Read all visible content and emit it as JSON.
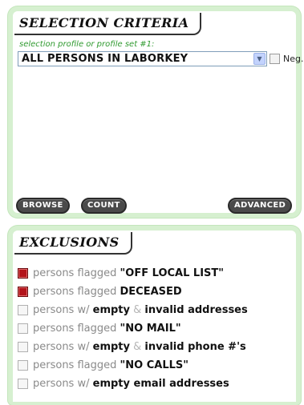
{
  "selection_criteria": {
    "title": "SELECTION CRITERIA",
    "hint": "selection profile or profile set #1:",
    "selected_profile": "ALL PERSONS IN LABORKEY",
    "neg_label": "Neg.",
    "buttons": {
      "browse": "BROWSE",
      "count": "COUNT",
      "advanced": "ADVANCED"
    }
  },
  "exclusions": {
    "title": "EXCLUSIONS",
    "items": [
      {
        "checked": true,
        "parts": [
          {
            "t": "persons flagged ",
            "s": "muted"
          },
          {
            "t": "\"OFF LOCAL LIST\"",
            "s": "strong"
          }
        ]
      },
      {
        "checked": true,
        "parts": [
          {
            "t": "persons flagged ",
            "s": "muted"
          },
          {
            "t": "DECEASED",
            "s": "strong"
          }
        ]
      },
      {
        "checked": false,
        "parts": [
          {
            "t": "persons w/ ",
            "s": "muted"
          },
          {
            "t": "empty",
            "s": "strong"
          },
          {
            "t": " & ",
            "s": "amp"
          },
          {
            "t": "invalid addresses",
            "s": "strong"
          }
        ]
      },
      {
        "checked": false,
        "parts": [
          {
            "t": "persons flagged ",
            "s": "muted"
          },
          {
            "t": "\"NO MAIL\"",
            "s": "strong"
          }
        ]
      },
      {
        "checked": false,
        "parts": [
          {
            "t": "persons w/ ",
            "s": "muted"
          },
          {
            "t": "empty",
            "s": "strong"
          },
          {
            "t": " & ",
            "s": "amp"
          },
          {
            "t": "invalid phone #'s",
            "s": "strong"
          }
        ]
      },
      {
        "checked": false,
        "parts": [
          {
            "t": "persons flagged ",
            "s": "muted"
          },
          {
            "t": "\"NO CALLS\"",
            "s": "strong"
          }
        ]
      },
      {
        "checked": false,
        "parts": [
          {
            "t": "persons w/ ",
            "s": "muted"
          },
          {
            "t": "empty email addresses",
            "s": "strong"
          }
        ]
      }
    ]
  },
  "colors": {
    "panel_border": "#d6f0d0",
    "hint_text": "#2f9a2f",
    "checked_box": "#b3141b",
    "pill_button": "#4a4a4a"
  },
  "icons": {
    "dropdown": "chevron-down-icon",
    "checkbox_checked": "checked-checkbox-icon",
    "checkbox_unchecked": "unchecked-checkbox-icon"
  }
}
